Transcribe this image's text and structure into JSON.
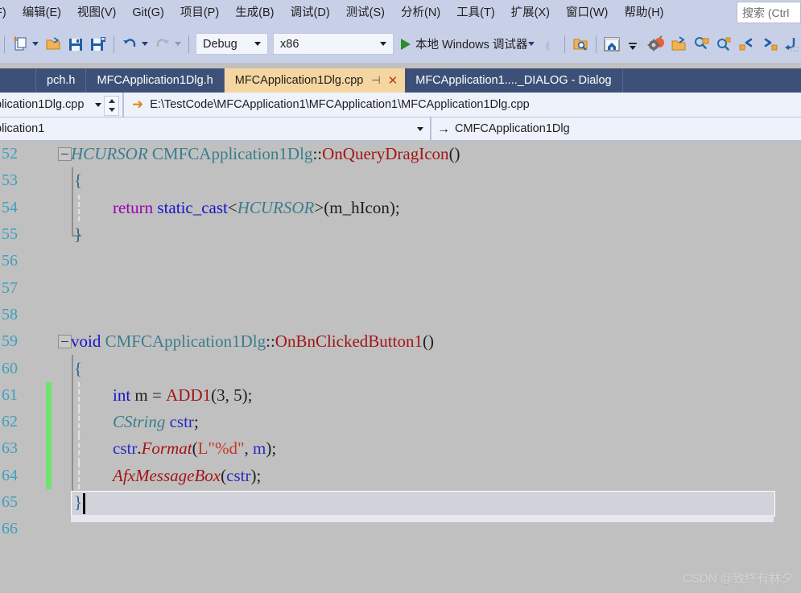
{
  "menu": {
    "items": [
      {
        "label": "F)",
        "name": "menu-file"
      },
      {
        "label": "编辑(E)",
        "name": "menu-edit"
      },
      {
        "label": "视图(V)",
        "name": "menu-view"
      },
      {
        "label": "Git(G)",
        "name": "menu-git"
      },
      {
        "label": "项目(P)",
        "name": "menu-project"
      },
      {
        "label": "生成(B)",
        "name": "menu-build"
      },
      {
        "label": "调试(D)",
        "name": "menu-debug"
      },
      {
        "label": "测试(S)",
        "name": "menu-test"
      },
      {
        "label": "分析(N)",
        "name": "menu-analyze"
      },
      {
        "label": "工具(T)",
        "name": "menu-tools"
      },
      {
        "label": "扩展(X)",
        "name": "menu-extensions"
      },
      {
        "label": "窗口(W)",
        "name": "menu-window"
      },
      {
        "label": "帮助(H)",
        "name": "menu-help"
      }
    ],
    "search_placeholder": "搜索 (Ctrl"
  },
  "toolbar": {
    "configuration": "Debug",
    "platform": "x86",
    "run_label": "本地 Windows 调试器",
    "icons": [
      "new-project-icon",
      "open-file-icon",
      "save-icon",
      "save-all-icon",
      "undo-icon",
      "redo-icon",
      "hot-reload-icon",
      "find-in-files-icon",
      "home-icon",
      "step-icon",
      "properties-icon",
      "open-folder-icon",
      "zoom-search-icon",
      "quick-find-icon",
      "step-back-icon",
      "step-forward-icon",
      "step-out-icon"
    ]
  },
  "tabs": [
    {
      "label": "pch.h",
      "active": false,
      "name": "tab-pch-h"
    },
    {
      "label": "MFCApplication1Dlg.h",
      "active": false,
      "name": "tab-mfcapplication1dlg-h"
    },
    {
      "label": "MFCApplication1Dlg.cpp",
      "active": true,
      "name": "tab-mfcapplication1dlg-cpp"
    },
    {
      "label": "MFCApplication1...._DIALOG - Dialog",
      "active": false,
      "name": "tab-dialog-designer"
    }
  ],
  "pathbar": {
    "file_combo": "plication1Dlg.cpp",
    "file_path": "E:\\TestCode\\MFCApplication1\\MFCApplication1\\MFCApplication1Dlg.cpp"
  },
  "navbar": {
    "project_combo": "plication1",
    "class_name": "CMFCApplication1Dlg"
  },
  "editor": {
    "line_numbers": [
      "52",
      "53",
      "54",
      "55",
      "56",
      "57",
      "58",
      "59",
      "60",
      "61",
      "62",
      "63",
      "64",
      "65",
      "66"
    ],
    "code_lines": [
      "HCURSOR CMFCApplication1Dlg::OnQueryDragIcon()",
      "{",
      "    return static_cast<HCURSOR>(m_hIcon);",
      "}",
      "",
      "",
      "",
      "void CMFCApplication1Dlg::OnBnClickedButton1()",
      "{",
      "    int m = ADD1(3, 5);",
      "    CString cstr;",
      "    cstr.Format(L\"%d\", m);",
      "    AfxMessageBox(cstr);",
      "}",
      ""
    ],
    "tokens": {
      "l52": {
        "type": "HCURSOR",
        "class": "CMFCApplication1Dlg",
        "scope": "::",
        "func": "OnQueryDragIcon",
        "parens": "()"
      },
      "l53": {
        "brace": "{"
      },
      "l54": {
        "ret": "return",
        "cast": "static_cast",
        "lt": "<",
        "type": "HCURSOR",
        "gt": ">",
        "open": "(",
        "var": "m_hIcon",
        "close": ")",
        "semi": ";"
      },
      "l55": {
        "brace": "}"
      },
      "l59": {
        "kw": "void",
        "class": "CMFCApplication1Dlg",
        "scope": "::",
        "func": "OnBnClickedButton1",
        "parens": "()"
      },
      "l60": {
        "brace": "{"
      },
      "l61": {
        "kw": "int",
        "var": "m",
        "eq": " = ",
        "func": "ADD1",
        "args": "(3, 5)",
        "semi": ";"
      },
      "l62": {
        "type": "CString",
        "var": "cstr",
        "semi": ";"
      },
      "l63": {
        "var": "cstr",
        "dot": ".",
        "func": "Format",
        "open": "(",
        "prefix": "L",
        "str": "\"%d\"",
        "comma": ", ",
        "arg": "m",
        "close": ")",
        "semi": ";"
      },
      "l64": {
        "func": "AfxMessageBox",
        "open": "(",
        "arg": "cstr",
        "close": ")",
        "semi": ";"
      },
      "l65": {
        "brace": "}"
      }
    },
    "change_bar_lines": [
      "61",
      "62",
      "63",
      "64"
    ],
    "current_line": "65"
  },
  "watermark": "CSDN @致终有林夕",
  "colors": {
    "menubar_bg": "#c8d0e8",
    "tabbar_bg": "#3d5178",
    "active_tab_bg": "#f6d6a0",
    "editor_bg": "#c0c0c0",
    "pathbar_bg": "#eef2fb",
    "line_number": "#3f9fc0",
    "change_bar_green": "#6ee36e",
    "keyword_blue": "#1414c8",
    "type_teal": "#3c7d8c",
    "function_red": "#a31515",
    "string_red": "#c0392b",
    "return_magenta": "#9b00b0",
    "run_green": "#2e8b2e"
  }
}
